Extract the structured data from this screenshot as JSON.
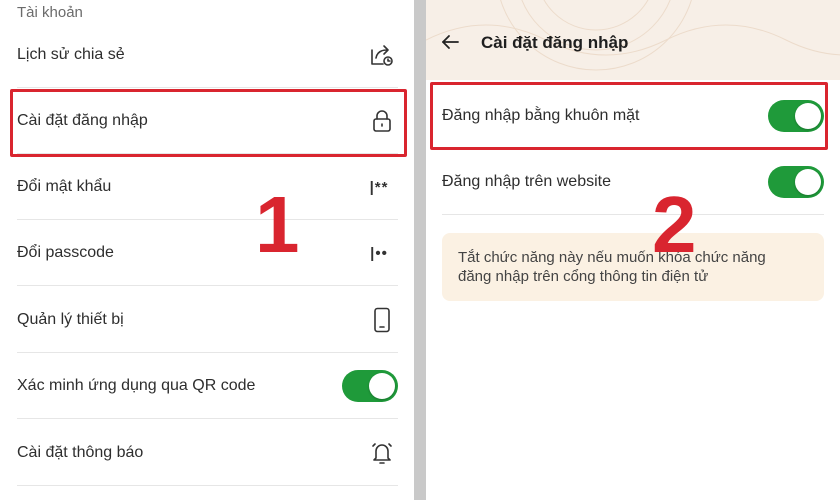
{
  "left_panel": {
    "section_title": "Tài khoản",
    "items": [
      {
        "label": "Lịch sử chia sẻ",
        "icon": "share-history-icon"
      },
      {
        "label": "Cài đặt đăng nhập",
        "icon": "lock-icon"
      },
      {
        "label": "Đổi mật khẩu",
        "icon": "password-icon",
        "icon_text": "|**"
      },
      {
        "label": "Đổi passcode",
        "icon": "passcode-icon",
        "icon_text": "|••"
      },
      {
        "label": "Quản lý thiết bị",
        "icon": "phone-icon"
      },
      {
        "label": "Xác minh ứng dụng qua QR code",
        "icon": "toggle",
        "toggle_on": true
      },
      {
        "label": "Cài đặt thông báo",
        "icon": "bell-icon"
      }
    ],
    "step_label": "1"
  },
  "right_panel": {
    "title": "Cài đặt đăng nhập",
    "items": [
      {
        "label": "Đăng nhập bằng khuôn mặt",
        "toggle_on": true
      },
      {
        "label": "Đăng nhập trên website",
        "toggle_on": true
      }
    ],
    "note_line1": "Tắt chức năng này nếu muốn khóa chức năng",
    "note_line2": "đăng nhập trên cổng thông tin điện tử",
    "step_label": "2"
  },
  "colors": {
    "highlight": "#d9252f",
    "toggle_on": "#1f9a3a",
    "header_bg": "#f7efe7",
    "note_bg": "#fbf1e3"
  }
}
